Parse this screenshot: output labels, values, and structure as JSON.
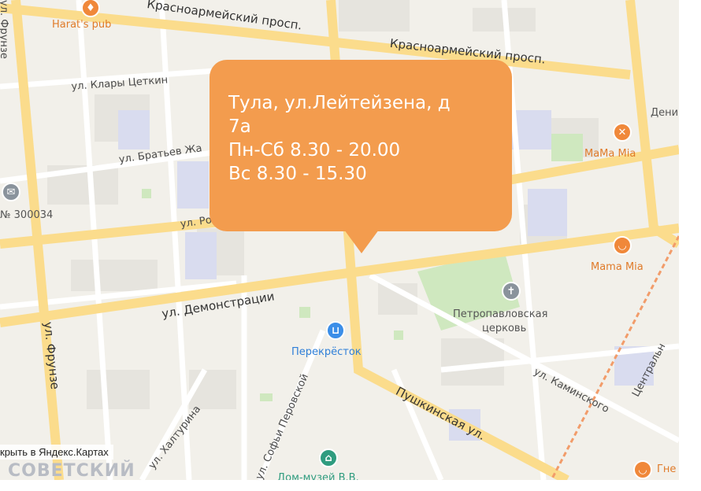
{
  "popup": {
    "line1": "Тула, ул.Лейтейзена, д",
    "line2": "7а",
    "line3": "Пн-Сб 8.30 - 20.00",
    "line4": "Вс 8.30 - 15.30",
    "color": "#f39c4e"
  },
  "streets": {
    "krasnoarm1": "Красноармейский просп.",
    "krasnoarm2": "Красноармейский просп.",
    "klary": "ул. Клары Цеткин",
    "bratiev": "ул. Братьев Жа",
    "ro": "ул. Ро",
    "demonstr": "ул. Демонстрации",
    "frunze_top": "ул. Фрунзе",
    "frunze_bottom": "ул. Фрунзе",
    "pushkinskaya": "Пушкинская ул.",
    "kaminskogo": "ул. Каминского",
    "centralnaya": "Центральн",
    "perovskoy": "ул. Софьи Перовской",
    "khalturina": "ул. Халтурина"
  },
  "pois": {
    "harats": {
      "name": "Harat's pub",
      "icon": "pub-icon",
      "color": "#f0883a"
    },
    "mamamia1": {
      "name": "MaMa Mia",
      "icon": "restaurant-icon",
      "color": "#f0883a"
    },
    "mamamia2": {
      "name": "Mama Mia",
      "icon": "cafe-icon",
      "color": "#f0883a"
    },
    "perekrestok": {
      "name": "Перекрёсток",
      "icon": "shop-icon",
      "color": "#3b8ee8"
    },
    "church_line1": "Петропавловская",
    "church_line2": "церковь",
    "church_icon": "church-icon",
    "post": {
      "name": "№ 300034",
      "icon": "mail-icon"
    },
    "deni": "Дени",
    "museum": {
      "name": "Дом-музей В.В.",
      "icon": "museum-icon",
      "color": "#2f9c7f"
    },
    "gne": {
      "name": "Гне",
      "icon": "cafe-icon",
      "color": "#f0883a"
    }
  },
  "footer": {
    "open_link": "крыть в Яндекс.Картах",
    "district": "СОВЕТСКИЙ"
  }
}
